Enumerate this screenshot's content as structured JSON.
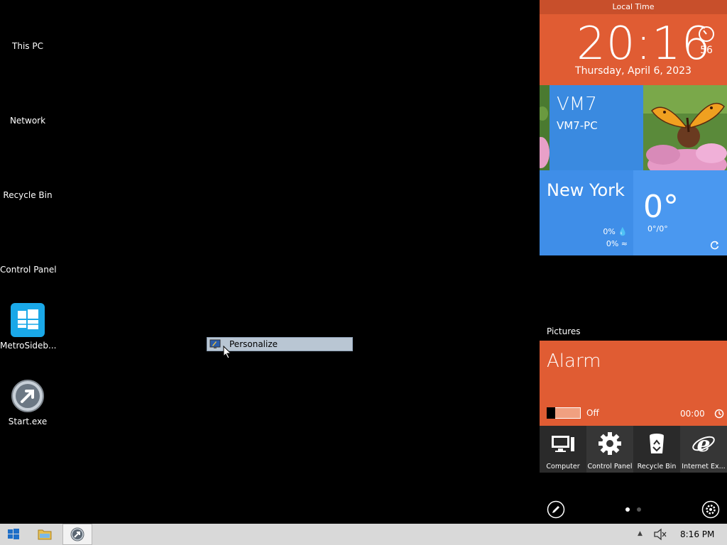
{
  "desktop": {
    "icons": [
      {
        "label": "This PC"
      },
      {
        "label": "Network"
      },
      {
        "label": "Recycle Bin"
      },
      {
        "label": "Control Panel"
      },
      {
        "label": "MetroSideb..."
      },
      {
        "label": "Start.exe"
      }
    ]
  },
  "context_menu": {
    "item_label": "Personalize"
  },
  "sidebar": {
    "clock": {
      "header": "Local Time",
      "time": "20:16",
      "seconds": "56",
      "date": "Thursday, April 6, 2023"
    },
    "user": {
      "name": "VM7",
      "pc_name": "VM7-PC"
    },
    "weather": {
      "city": "New York",
      "temp": "0°",
      "range": "0°/0°",
      "precip": "0%",
      "wind": "0%"
    },
    "pictures_label": "Pictures",
    "alarm": {
      "title": "Alarm",
      "state": "Off",
      "time": "00:00"
    },
    "shortcuts": [
      {
        "label": "Computer"
      },
      {
        "label": "Control Panel"
      },
      {
        "label": "Recycle Bin"
      },
      {
        "label": "Internet Ex..."
      }
    ]
  },
  "taskbar": {
    "clock": "8:16 PM"
  },
  "colors": {
    "accent_orange": "#e05c33",
    "accent_blue": "#3a8ae0"
  }
}
